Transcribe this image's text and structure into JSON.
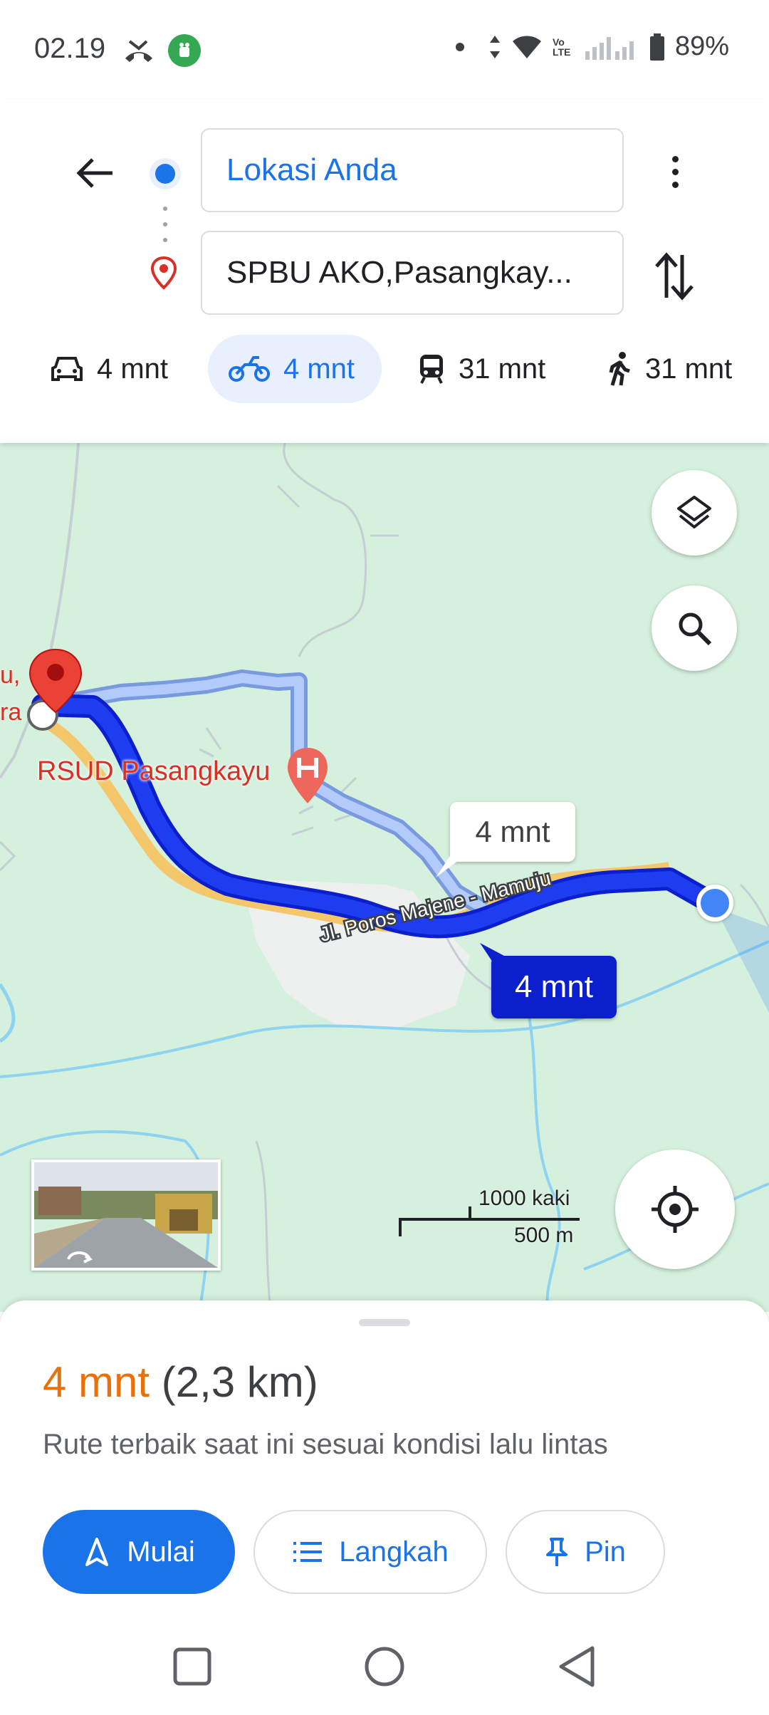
{
  "status_bar": {
    "time": "02.19",
    "battery": "89%",
    "network_label": "Vo LTE"
  },
  "search": {
    "origin": "Lokasi Anda",
    "destination": "SPBU AKO,Pasangkay..."
  },
  "modes": [
    {
      "icon": "car-icon",
      "label": "4 mnt",
      "selected": false
    },
    {
      "icon": "motorcycle-icon",
      "label": "4 mnt",
      "selected": true
    },
    {
      "icon": "train-icon",
      "label": "31 mnt",
      "selected": false
    },
    {
      "icon": "walk-icon",
      "label": "31 mnt",
      "selected": false
    }
  ],
  "map": {
    "hospital": "RSUD Pasangkayu",
    "edge_label_line1": "u,",
    "edge_label_line2": "ra",
    "road_name": "Jl. Poros Majene - Mamuju",
    "alt_route_time": "4 mnt",
    "main_route_time": "4 mnt",
    "scale_feet": "1000 kaki",
    "scale_meters": "500 m",
    "colors": {
      "map_bg": "#d5f0dd",
      "main_route": "#0b1fcc",
      "alt_route": "#a8c4f5",
      "water": "#8ed3f0"
    }
  },
  "route_summary": {
    "duration": "4 mnt",
    "distance": "(2,3 km)",
    "description": "Rute terbaik saat ini sesuai kondisi lalu lintas"
  },
  "actions": {
    "start": "Mulai",
    "steps": "Langkah",
    "pin": "Pin"
  },
  "colors": {
    "accent": "#1a73e8",
    "duration": "#e8710a"
  }
}
